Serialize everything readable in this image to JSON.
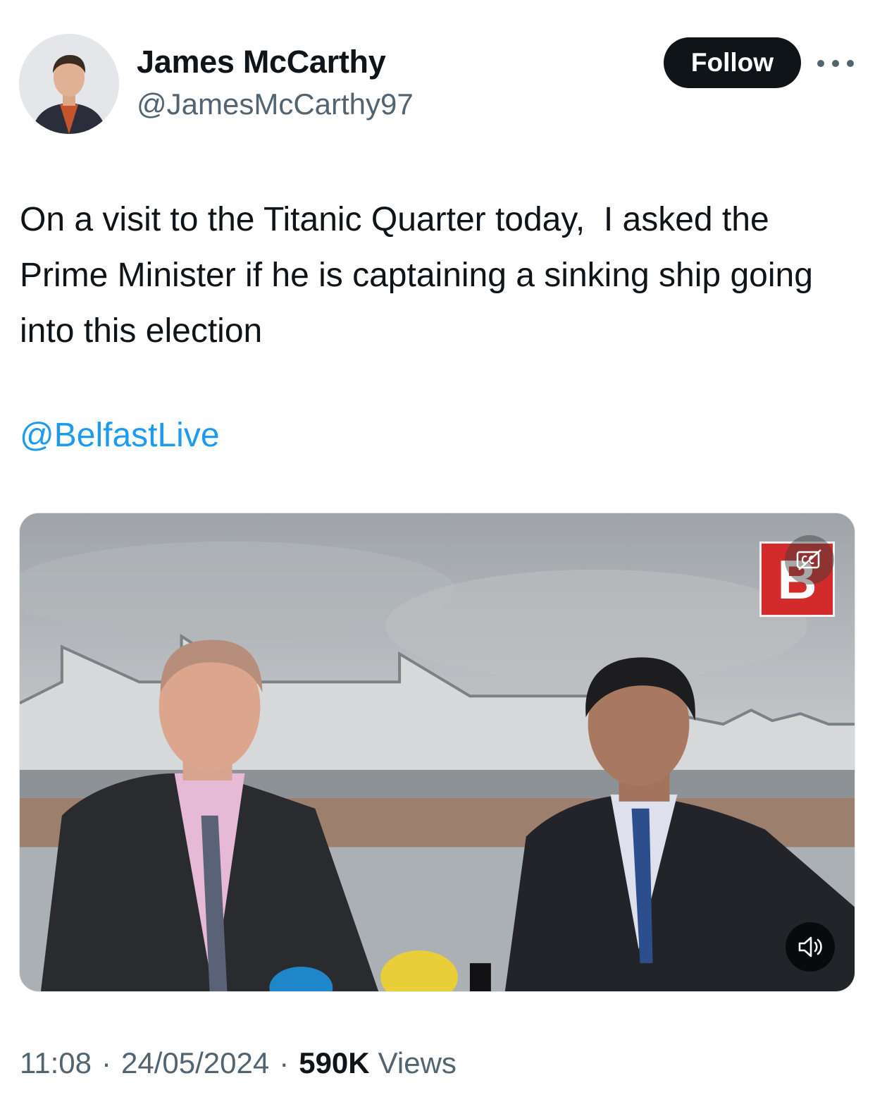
{
  "author": {
    "display_name": "James McCarthy",
    "handle": "@JamesMcCarthy97"
  },
  "header": {
    "follow_label": "Follow",
    "more_icon": "more-horizontal-icon"
  },
  "tweet": {
    "text": "On a visit to the Titanic Quarter today,  I asked the Prime Minister if he is captaining a sinking ship going into this election",
    "mention": "@BelfastLive"
  },
  "media": {
    "type": "video",
    "logo_letter": "B",
    "captions_icon": "closed-captions-icon",
    "volume_icon": "volume-icon",
    "colors": {
      "logo_bg": "#d32b2b"
    }
  },
  "meta": {
    "time": "11:08",
    "date": "24/05/2024",
    "views_count": "590K",
    "views_label": "Views"
  },
  "colors": {
    "text": "#0f1419",
    "secondary": "#536471",
    "link": "#1d9bf0",
    "button_bg": "#0f1419"
  }
}
